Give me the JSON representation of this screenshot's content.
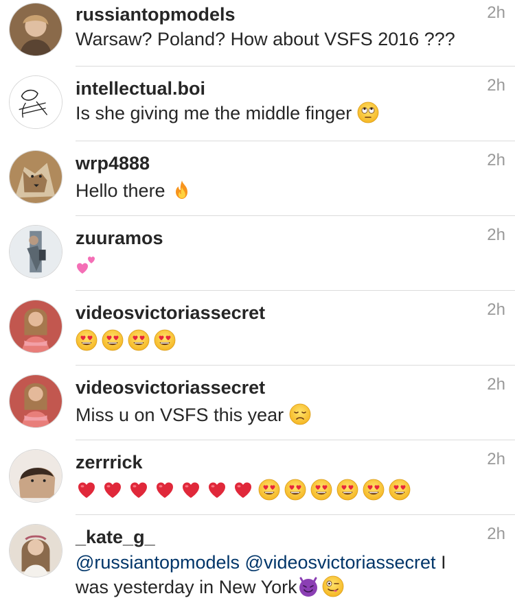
{
  "comments": [
    {
      "username": "russiantopmodels",
      "text": "Warsaw? Poland? How about VSFS 2016 ???",
      "time": "2h",
      "avatar_color": "#8a6a4a"
    },
    {
      "username": "intellectual.boi",
      "text": "Is she giving me the middle finger",
      "time": "2h",
      "emoji": "face-with-rolling-eyes-emoji",
      "avatar_color": "#ffffff"
    },
    {
      "username": "wrp4888",
      "text": "Hello there",
      "time": "2h",
      "emoji": "fire-emoji",
      "avatar_color": "#b08a5c"
    },
    {
      "username": "zuuramos",
      "text": "",
      "time": "2h",
      "emoji": "two-hearts-emoji",
      "avatar_color": "#9aa0a6"
    },
    {
      "username": "videosvictoriassecret",
      "text": "",
      "time": "2h",
      "emojis": [
        "heart-eyes-emoji",
        "heart-eyes-emoji",
        "heart-eyes-emoji",
        "heart-eyes-emoji"
      ],
      "avatar_color": "#c2574f"
    },
    {
      "username": "videosvictoriassecret",
      "text": "Miss u on VSFS this year",
      "time": "2h",
      "emoji": "disappointed-face-emoji",
      "avatar_color": "#c2574f"
    },
    {
      "username": "zerrrick",
      "text": "",
      "time": "2h",
      "emojis": [
        "red-heart-emoji",
        "red-heart-emoji",
        "red-heart-emoji",
        "red-heart-emoji",
        "red-heart-emoji",
        "red-heart-emoji",
        "red-heart-emoji",
        "heart-eyes-emoji",
        "heart-eyes-emoji",
        "heart-eyes-emoji",
        "heart-eyes-emoji",
        "heart-eyes-emoji",
        "heart-eyes-emoji"
      ],
      "avatar_color": "#c9a586"
    },
    {
      "username": "_kate_g_",
      "mention1": "@russiantopmodels",
      "mention2": "@videosvictoriassecret",
      "text_after_mentions": " I was yesterday in New York",
      "time": "2h",
      "emojis": [
        "smiling-imp-emoji",
        "winking-tongue-emoji"
      ],
      "avatar_color": "#c8b9a6"
    }
  ],
  "colors": {
    "username": "#262626",
    "text": "#262626",
    "timestamp": "#999999",
    "mention": "#003569",
    "divider": "#dbdbdb"
  }
}
